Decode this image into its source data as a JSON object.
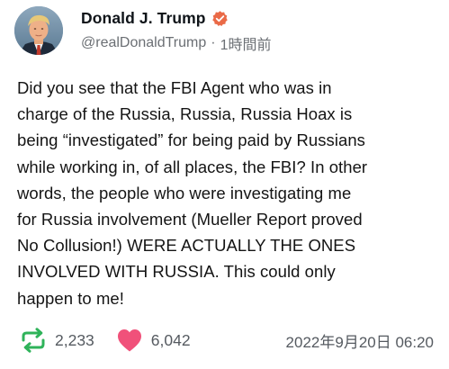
{
  "author": {
    "display_name": "Donald J. Trump",
    "handle": "@realDonaldTrump",
    "separator": "·",
    "relative_time": "1時間前",
    "avatar_icon": "profile-photo",
    "verified_icon": "verified-badge-icon"
  },
  "post": {
    "text": "Did you see that the FBI Agent who was in\ncharge of the Russia, Russia, Russia Hoax is\nbeing “investigated” for being paid by Russians\nwhile working in, of all places, the FBI? In other\nwords, the people who were investigating me\nfor Russia involvement (Mueller Report proved\nNo Collusion!) WERE ACTUALLY THE ONES\nINVOLVED WITH RUSSIA. This could only\nhappen to me!"
  },
  "stats": {
    "reposts": "2,233",
    "likes": "6,042",
    "timestamp": "2022年9月20日 06:20"
  },
  "colors": {
    "verified": "#ea6a47",
    "repost": "#2fb35a",
    "like": "#f0517a",
    "muted_text": "#6b6f74"
  }
}
